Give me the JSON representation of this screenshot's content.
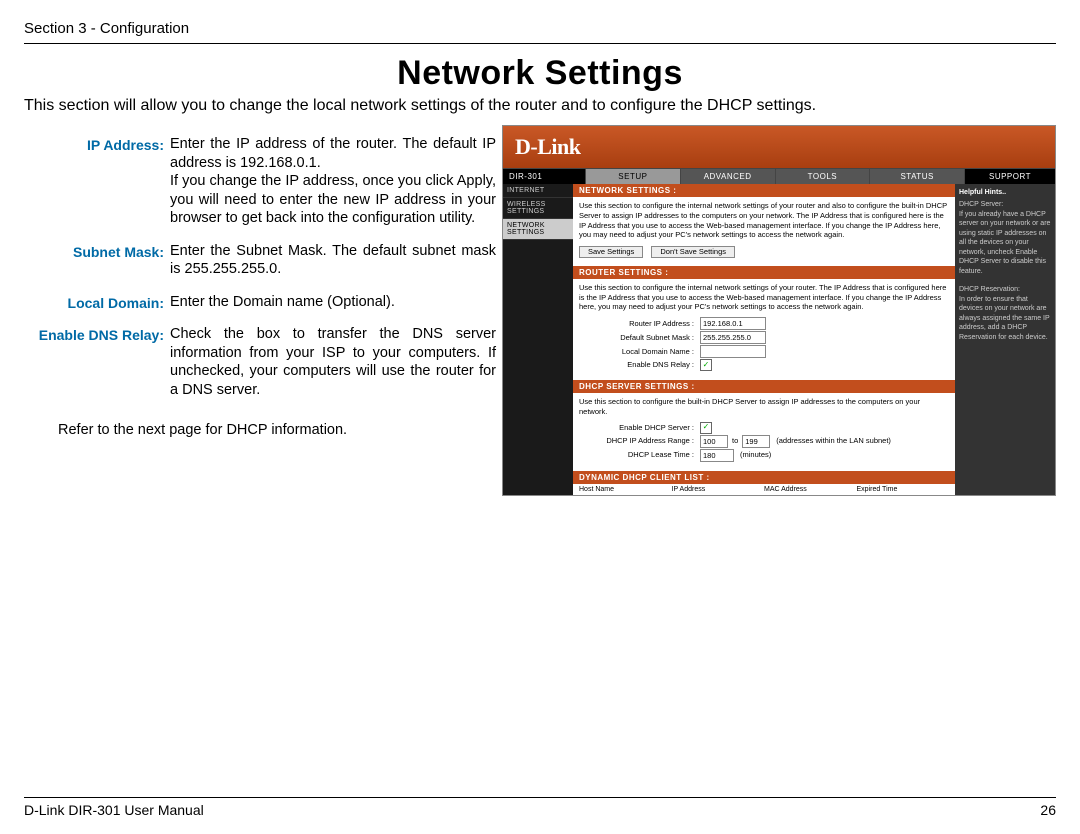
{
  "header": "Section 3 - Configuration",
  "title": "Network Settings",
  "intro": "This section will allow you to change the local network settings of the router and to configure the DHCP settings.",
  "definitions": [
    {
      "label": "IP Address:",
      "text": "Enter the IP address of the router. The default IP address is 192.168.0.1.\nIf you change the IP address, once you click Apply, you will need to enter the new IP address in your browser to get back into the configuration utility."
    },
    {
      "label": "Subnet Mask:",
      "text": "Enter the Subnet Mask. The default subnet mask is 255.255.255.0."
    },
    {
      "label": "Local Domain:",
      "text": "Enter the Domain name (Optional)."
    },
    {
      "label": "Enable DNS Relay:",
      "text": "Check the box to transfer the DNS server information from your ISP to your computers. If unchecked, your computers will use the router for a DNS server."
    }
  ],
  "refer": "Refer to the next page for DHCP information.",
  "router": {
    "brand": "D-Link",
    "model": "DIR-301",
    "tabs": [
      "SETUP",
      "ADVANCED",
      "TOOLS",
      "STATUS"
    ],
    "support": "SUPPORT",
    "sidebar": [
      "INTERNET",
      "WIRELESS SETTINGS",
      "NETWORK SETTINGS"
    ],
    "hints_title": "Helpful Hints..",
    "hints": "DHCP Server:\nIf you already have a DHCP server on your network or are using static IP addresses on all the devices on your network, uncheck Enable DHCP Server to disable this feature.\n\nDHCP Reservation:\nIn order to ensure that devices on your network are always assigned the same IP address, add a DHCP Reservation for each device.",
    "sec1_title": "NETWORK SETTINGS :",
    "sec1_text": "Use this section to configure the internal network settings of your router and also to configure the built-in DHCP Server to assign IP addresses to the computers on your network. The IP Address that is configured here is the IP Address that you use to access the Web-based management interface. If you change the IP Address here, you may need to adjust your PC's network settings to access the network again.",
    "save": "Save Settings",
    "dont_save": "Don't Save Settings",
    "sec2_title": "ROUTER SETTINGS :",
    "sec2_text": "Use this section to configure the internal network settings of your router. The IP Address that is configured here is the IP Address that you use to access the Web-based management interface. If you change the IP Address here, you may need to adjust your PC's network settings to access the network again.",
    "fields2": {
      "ip_label": "Router IP Address :",
      "ip_val": "192.168.0.1",
      "mask_label": "Default Subnet Mask :",
      "mask_val": "255.255.255.0",
      "domain_label": "Local Domain Name :",
      "domain_val": "",
      "dns_label": "Enable DNS Relay :"
    },
    "sec3_title": "DHCP SERVER SETTINGS :",
    "sec3_text": "Use this section to configure the built-in DHCP Server to assign IP addresses to the computers on your network.",
    "fields3": {
      "enable_label": "Enable DHCP Server :",
      "range_label": "DHCP IP Address Range :",
      "from": "100",
      "to_word": "to",
      "to": "199",
      "range_note": "(addresses within the LAN subnet)",
      "lease_label": "DHCP Lease Time :",
      "lease": "180",
      "lease_unit": "(minutes)"
    },
    "sec4_title": "DYNAMIC DHCP CLIENT LIST :",
    "client_cols": [
      "Host Name",
      "IP Address",
      "MAC Address",
      "Expired Time"
    ]
  },
  "footer": {
    "left": "D-Link DIR-301 User Manual",
    "right": "26"
  }
}
